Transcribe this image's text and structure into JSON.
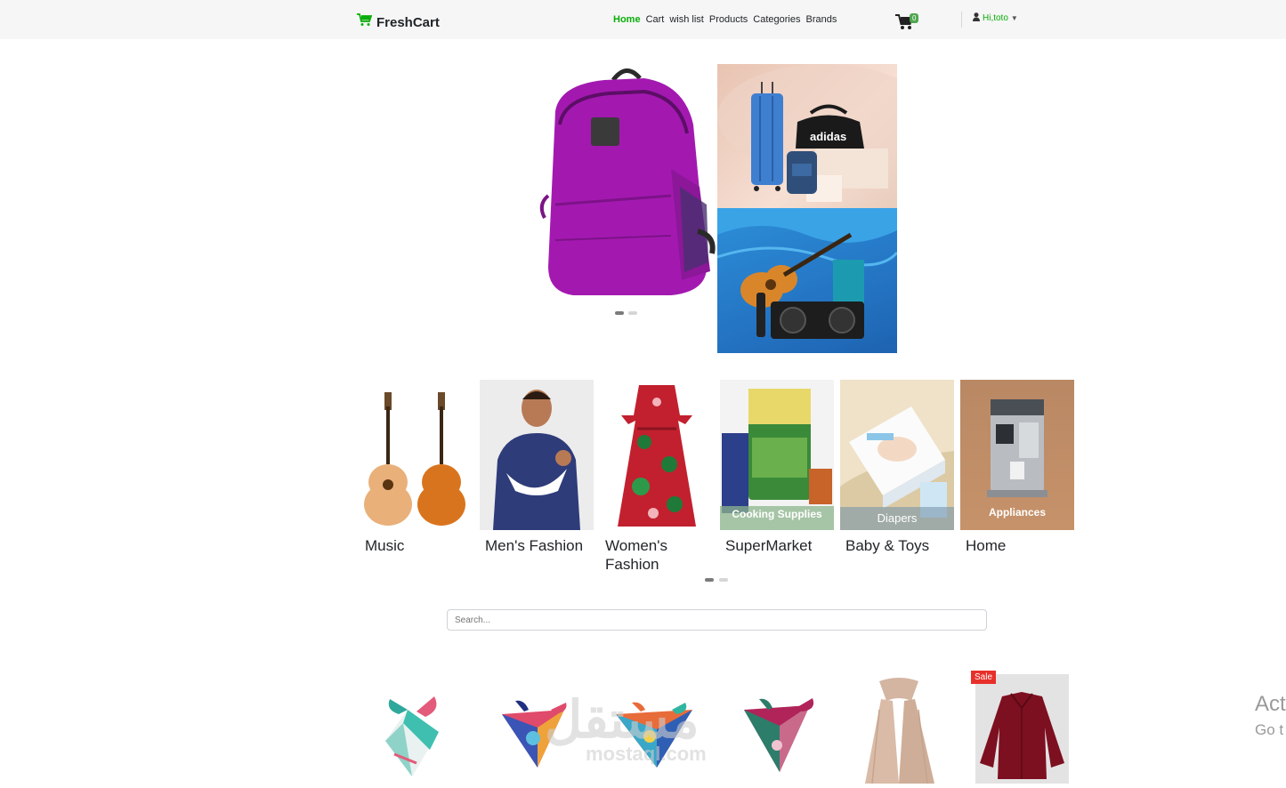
{
  "brand": {
    "name": "FreshCart",
    "icon": "cart-icon",
    "color": "#0aad0a"
  },
  "nav": {
    "links": [
      "Home",
      "Cart",
      "wish list",
      "Products",
      "Categories",
      "Brands"
    ],
    "active": "Home"
  },
  "cart": {
    "count": "0"
  },
  "user": {
    "greeting": "Hi,toto",
    "icon": "user-icon"
  },
  "hero": {
    "side_banner_top_text": "adidas",
    "slide_count": 2,
    "active_slide": 1
  },
  "categories": {
    "items": [
      {
        "label": "Music",
        "overlay": ""
      },
      {
        "label": "Men's Fashion",
        "overlay": ""
      },
      {
        "label": "Women's Fashion",
        "overlay": ""
      },
      {
        "label": "SuperMarket",
        "overlay": "Cooking Supplies"
      },
      {
        "label": "Baby & Toys",
        "overlay": "Diapers"
      },
      {
        "label": "Home",
        "overlay": "Appliances"
      }
    ]
  },
  "search": {
    "placeholder": "Search..."
  },
  "products": {
    "sale_badge": "Sale"
  },
  "watermark": {
    "main": "مستقل",
    "sub": "mostaql.com"
  },
  "activation": {
    "line1": "Act",
    "line2": "Go t"
  }
}
